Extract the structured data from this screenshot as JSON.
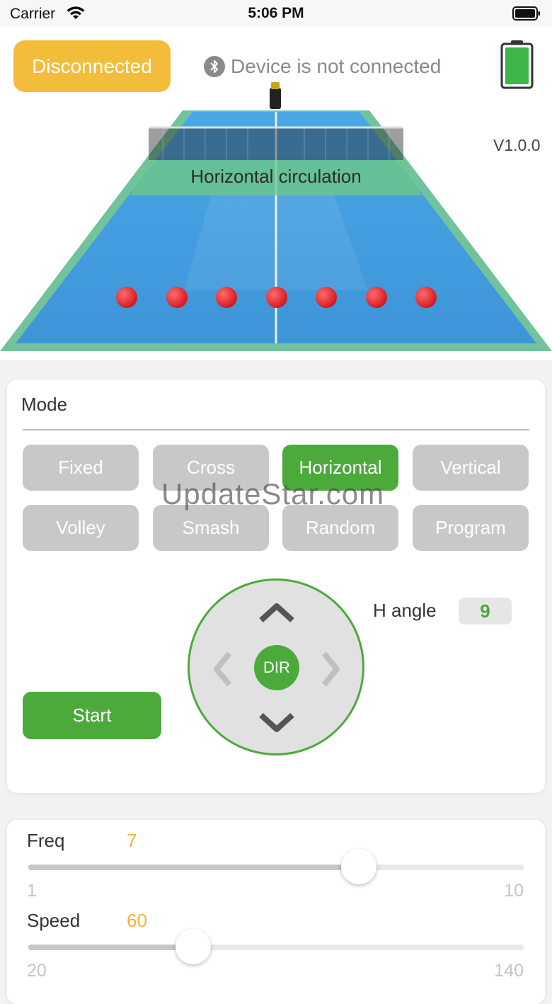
{
  "status_bar": {
    "carrier": "Carrier",
    "time": "5:06 PM"
  },
  "header": {
    "connect_button": "Disconnected",
    "connection_status": "Device is not connected",
    "version": "V1.0.0"
  },
  "scene": {
    "mode_caption": "Horizontal circulation",
    "ball_count": 7,
    "colors": {
      "table": "#3e9be0",
      "border": "#6ec39a",
      "ball": "#e8202a"
    }
  },
  "mode_panel": {
    "title": "Mode",
    "modes": [
      {
        "label": "Fixed",
        "active": false
      },
      {
        "label": "Cross",
        "active": false
      },
      {
        "label": "Horizontal",
        "active": true
      },
      {
        "label": "Vertical",
        "active": false
      },
      {
        "label": "Volley",
        "active": false
      },
      {
        "label": "Smash",
        "active": false
      },
      {
        "label": "Random",
        "active": false
      },
      {
        "label": "Program",
        "active": false
      }
    ],
    "watermark": "UpdateStar.com",
    "start_button": "Start",
    "dpad_center": "DIR",
    "h_angle_label": "H angle",
    "h_angle_value": "9"
  },
  "sliders": {
    "freq": {
      "label": "Freq",
      "value": "7",
      "min": "1",
      "max": "10",
      "numeric": {
        "value": 7,
        "min": 1,
        "max": 10
      }
    },
    "speed": {
      "label": "Speed",
      "value": "60",
      "min": "20",
      "max": "140",
      "numeric": {
        "value": 60,
        "min": 20,
        "max": 140
      }
    }
  },
  "theme": {
    "accent_green": "#4caa3b",
    "warning_yellow": "#f3bd3b",
    "value_orange": "#f0b534"
  }
}
